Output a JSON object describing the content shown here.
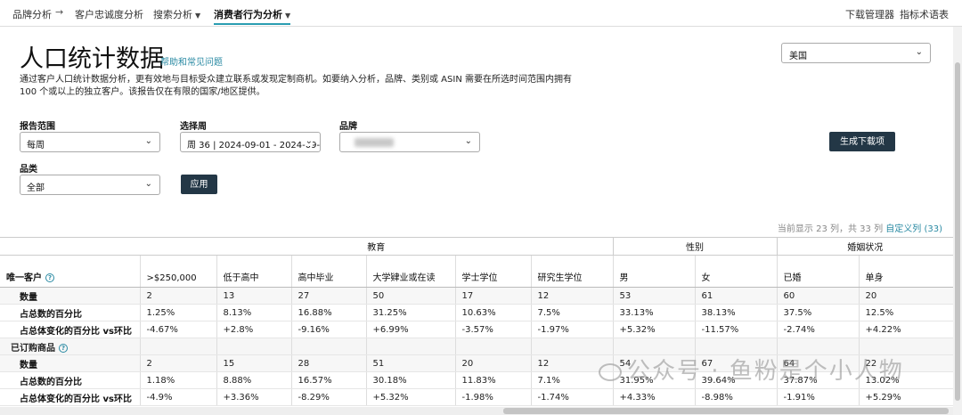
{
  "nav": {
    "items": [
      "品牌分析",
      "客户忠诚度分析",
      "搜索分析",
      "消费者行为分析"
    ],
    "right": [
      "下载管理器",
      "指标术语表"
    ]
  },
  "page": {
    "title": "人口统计数据",
    "help_link": "帮助和常见问题",
    "description": "通过客户人口统计数据分析，更有效地与目标受众建立联系或发现定制商机。如要纳入分析，品牌、类别或 ASIN 需要在所选时间范围内拥有 100 个或以上的独立客户。该报告仅在有限的国家/地区提供。"
  },
  "country": {
    "value": "美国"
  },
  "filters": {
    "report_range_label": "报告范围",
    "report_range_value": "每周",
    "week_label": "选择周",
    "week_value": "周 36 | 2024-09-01 - 2024-09-",
    "brand_label": "品牌",
    "category_label": "品类",
    "category_value": "全部",
    "apply_label": "应用",
    "generate_label": "生成下载项"
  },
  "display_info": {
    "text": "当前显示 23 列，共 33 列",
    "custom_link": "自定义列 (33)"
  },
  "table": {
    "groups": {
      "education": "教育",
      "gender": "性别",
      "marital": "婚姻状况"
    },
    "first_header": "唯一客户",
    "columns": [
      ">$250,000",
      "低于高中",
      "高中毕业",
      "大学肄业或在读",
      "学士学位",
      "研究生学位",
      "男",
      "女",
      "已婚",
      "单身"
    ],
    "sections": [
      {
        "title": "",
        "rows": [
          {
            "label": "数量",
            "values": [
              "2",
              "13",
              "27",
              "50",
              "17",
              "12",
              "53",
              "61",
              "60",
              "20"
            ]
          },
          {
            "label": "占总数的百分比",
            "values": [
              "1.25%",
              "8.13%",
              "16.88%",
              "31.25%",
              "10.63%",
              "7.5%",
              "33.13%",
              "38.13%",
              "37.5%",
              "12.5%"
            ]
          },
          {
            "label": "占总体变化的百分比 vs环比",
            "values": [
              "-4.67%",
              "+2.8%",
              "-9.16%",
              "+6.99%",
              "-3.57%",
              "-1.97%",
              "+5.32%",
              "-11.57%",
              "-2.74%",
              "+4.22%"
            ]
          }
        ]
      },
      {
        "title": "已订购商品",
        "rows": [
          {
            "label": "数量",
            "values": [
              "2",
              "15",
              "28",
              "51",
              "20",
              "12",
              "54",
              "67",
              "64",
              "22"
            ]
          },
          {
            "label": "占总数的百分比",
            "values": [
              "1.18%",
              "8.88%",
              "16.57%",
              "30.18%",
              "11.83%",
              "7.1%",
              "31.95%",
              "39.64%",
              "37.87%",
              "13.02%"
            ]
          },
          {
            "label": "占总体变化的百分比 vs环比",
            "values": [
              "-4.9%",
              "+3.36%",
              "-8.29%",
              "+5.32%",
              "-1.98%",
              "-1.74%",
              "+4.33%",
              "-8.98%",
              "-1.91%",
              "+5.29%"
            ]
          }
        ]
      }
    ]
  },
  "watermark": {
    "text": "公众号 · 鱼粉是个小人物"
  }
}
